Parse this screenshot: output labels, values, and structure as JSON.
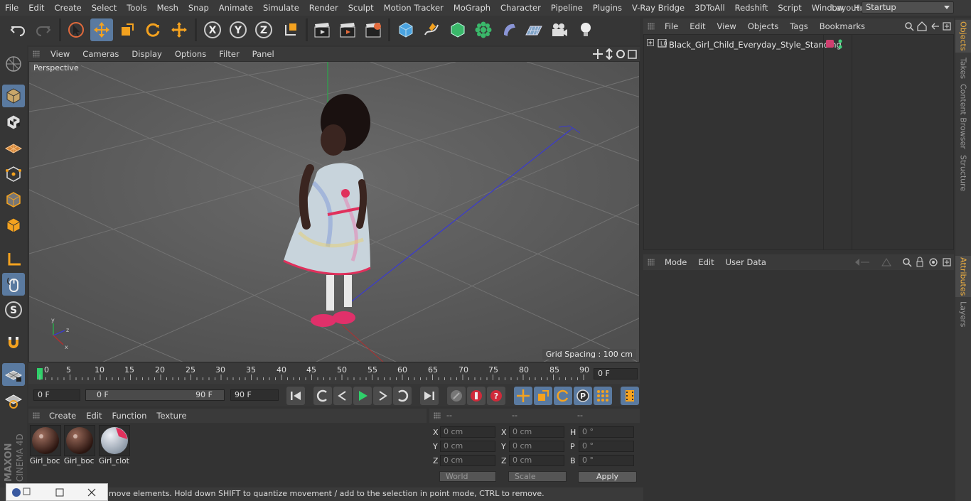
{
  "menubar": {
    "items": [
      "File",
      "Edit",
      "Create",
      "Select",
      "Tools",
      "Mesh",
      "Snap",
      "Animate",
      "Simulate",
      "Render",
      "Sculpt",
      "Motion Tracker",
      "MoGraph",
      "Character",
      "Pipeline",
      "Plugins",
      "V-Ray Bridge",
      "3DToAll",
      "Redshift",
      "Script",
      "Window",
      "Help"
    ],
    "layout_label": "Layout:",
    "layout_value": "Startup"
  },
  "viewport": {
    "menu": [
      "View",
      "Cameras",
      "Display",
      "Options",
      "Filter",
      "Panel"
    ],
    "label": "Perspective",
    "grid_spacing": "Grid Spacing : 100 cm"
  },
  "timeline": {
    "ticks": [
      "0",
      "5",
      "10",
      "15",
      "20",
      "25",
      "30",
      "35",
      "40",
      "45",
      "50",
      "55",
      "60",
      "65",
      "70",
      "75",
      "80",
      "85",
      "90"
    ],
    "frame_field": "0 F",
    "start_field": "0 F",
    "range_start": "0 F",
    "range_end": "90 F",
    "end_field": "90 F"
  },
  "materials": {
    "menu": [
      "Create",
      "Edit",
      "Function",
      "Texture"
    ],
    "items": [
      {
        "label": "Girl_boc"
      },
      {
        "label": "Girl_boc"
      },
      {
        "label": "Girl_clot"
      }
    ]
  },
  "coordinates": {
    "headers": [
      "--",
      "--",
      "--"
    ],
    "rows": [
      {
        "a": "X",
        "av": "0 cm",
        "b": "X",
        "bv": "0 cm",
        "c": "H",
        "cv": "0 °"
      },
      {
        "a": "Y",
        "av": "0 cm",
        "b": "Y",
        "bv": "0 cm",
        "c": "P",
        "cv": "0 °"
      },
      {
        "a": "Z",
        "av": "0 cm",
        "b": "Z",
        "bv": "0 cm",
        "c": "B",
        "cv": "0 °"
      }
    ],
    "space": "World",
    "mode": "Scale",
    "apply": "Apply"
  },
  "status": {
    "text": "move elements. Hold down SHIFT to quantize movement / add to the selection in point mode, CTRL to remove."
  },
  "object_manager": {
    "menu": [
      "File",
      "Edit",
      "View",
      "Objects",
      "Tags",
      "Bookmarks"
    ],
    "object_name": "Black_Girl_Child_Everyday_Style_Standing"
  },
  "attributes": {
    "menu": [
      "Mode",
      "Edit",
      "User Data"
    ]
  },
  "right_tabs": [
    "Objects",
    "Takes",
    "Content Browser",
    "Structure",
    "Attributes",
    "Layers"
  ],
  "colors": {
    "accent_blue": "#5a7aa0",
    "tab_active": "#f0b040",
    "layer_tag": "#d04070"
  }
}
